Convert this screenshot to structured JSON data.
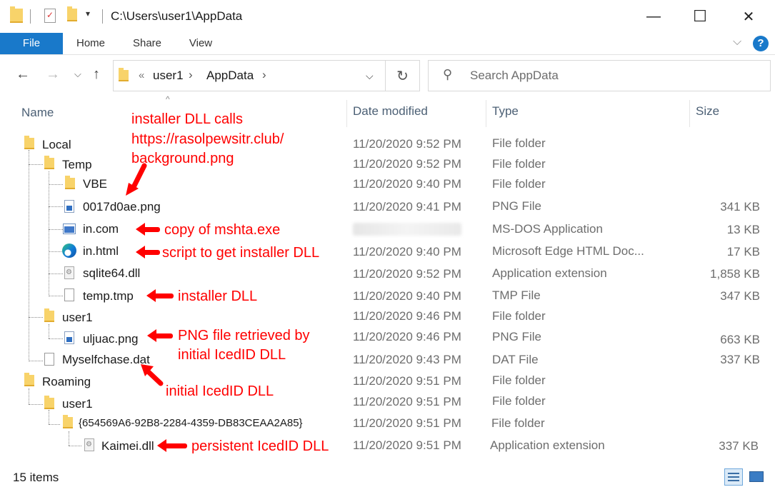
{
  "window": {
    "title": "C:\\Users\\user1\\AppData",
    "minimize_glyph": "—",
    "maximize_glyph": "☐",
    "close_glyph": "✕"
  },
  "ribbon": {
    "tabs": [
      {
        "label": "File"
      },
      {
        "label": "Home"
      },
      {
        "label": "Share"
      },
      {
        "label": "View"
      }
    ]
  },
  "address": {
    "overflow": "«",
    "breadcrumb": [
      "user1",
      "AppData"
    ],
    "separator": "›",
    "search_placeholder": "Search AppData"
  },
  "columns": {
    "name": "Name",
    "date_modified": "Date modified",
    "type": "Type",
    "size": "Size"
  },
  "rows": [
    {
      "name": "Local",
      "date": "11/20/2020 9:52 PM",
      "type": "File folder",
      "size": "",
      "icon": "folder-icon"
    },
    {
      "name": "Temp",
      "date": "11/20/2020 9:52 PM",
      "type": "File folder",
      "size": "",
      "icon": "folder-icon"
    },
    {
      "name": "VBE",
      "date": "11/20/2020 9:40 PM",
      "type": "File folder",
      "size": "",
      "icon": "folder-icon"
    },
    {
      "name": "0017d0ae.png",
      "date": "11/20/2020 9:41 PM",
      "type": "PNG File",
      "size": "341 KB",
      "icon": "png-file-icon"
    },
    {
      "name": "in.com",
      "date": "",
      "type": "MS-DOS Application",
      "size": "13 KB",
      "icon": "msdos-app-icon"
    },
    {
      "name": "in.html",
      "date": "11/20/2020 9:40 PM",
      "type": "Microsoft Edge HTML Doc...",
      "size": "17 KB",
      "icon": "edge-icon"
    },
    {
      "name": "sqlite64.dll",
      "date": "11/20/2020 9:52 PM",
      "type": "Application extension",
      "size": "1,858 KB",
      "icon": "dll-file-icon"
    },
    {
      "name": "temp.tmp",
      "date": "11/20/2020 9:40 PM",
      "type": "TMP File",
      "size": "347 KB",
      "icon": "blank-file-icon"
    },
    {
      "name": "user1",
      "date": "11/20/2020 9:46 PM",
      "type": "File folder",
      "size": "",
      "icon": "folder-icon"
    },
    {
      "name": "uljuac.png",
      "date": "11/20/2020 9:46 PM",
      "type": "PNG File",
      "size": "663 KB",
      "icon": "png-file-icon"
    },
    {
      "name": "Myselfchase.dat",
      "date": "11/20/2020 9:43 PM",
      "type": "DAT File",
      "size": "337 KB",
      "icon": "blank-file-icon"
    },
    {
      "name": "Roaming",
      "date": "11/20/2020 9:51 PM",
      "type": "File folder",
      "size": "",
      "icon": "folder-icon"
    },
    {
      "name": "user1",
      "date": "11/20/2020 9:51 PM",
      "type": "File folder",
      "size": "",
      "icon": "folder-icon"
    },
    {
      "name": "{654569A6-92B8-2284-4359-DB83CEAA2A85}",
      "date": "11/20/2020 9:51 PM",
      "type": "File folder",
      "size": "",
      "icon": "folder-icon"
    },
    {
      "name": "Kaimei.dll",
      "date": "11/20/2020 9:51 PM",
      "type": "Application extension",
      "size": "337 KB",
      "icon": "dll-file-icon"
    }
  ],
  "annotations": {
    "installer_calls": [
      "installer DLL calls",
      "https://rasolpewsitr.club/",
      "background.png"
    ],
    "mshta": "copy of mshta.exe",
    "script": "script to get installer DLL",
    "installer": "installer DLL",
    "png_retrieved": [
      "PNG file retrieved by",
      "initial IcedID DLL"
    ],
    "initial": "initial IcedID DLL",
    "persistent": "persistent IcedID DLL",
    "color": "#ff0000"
  },
  "status": {
    "item_count": "15 items"
  },
  "colors": {
    "accent": "#1979ca",
    "folder": "#f8d36a"
  }
}
